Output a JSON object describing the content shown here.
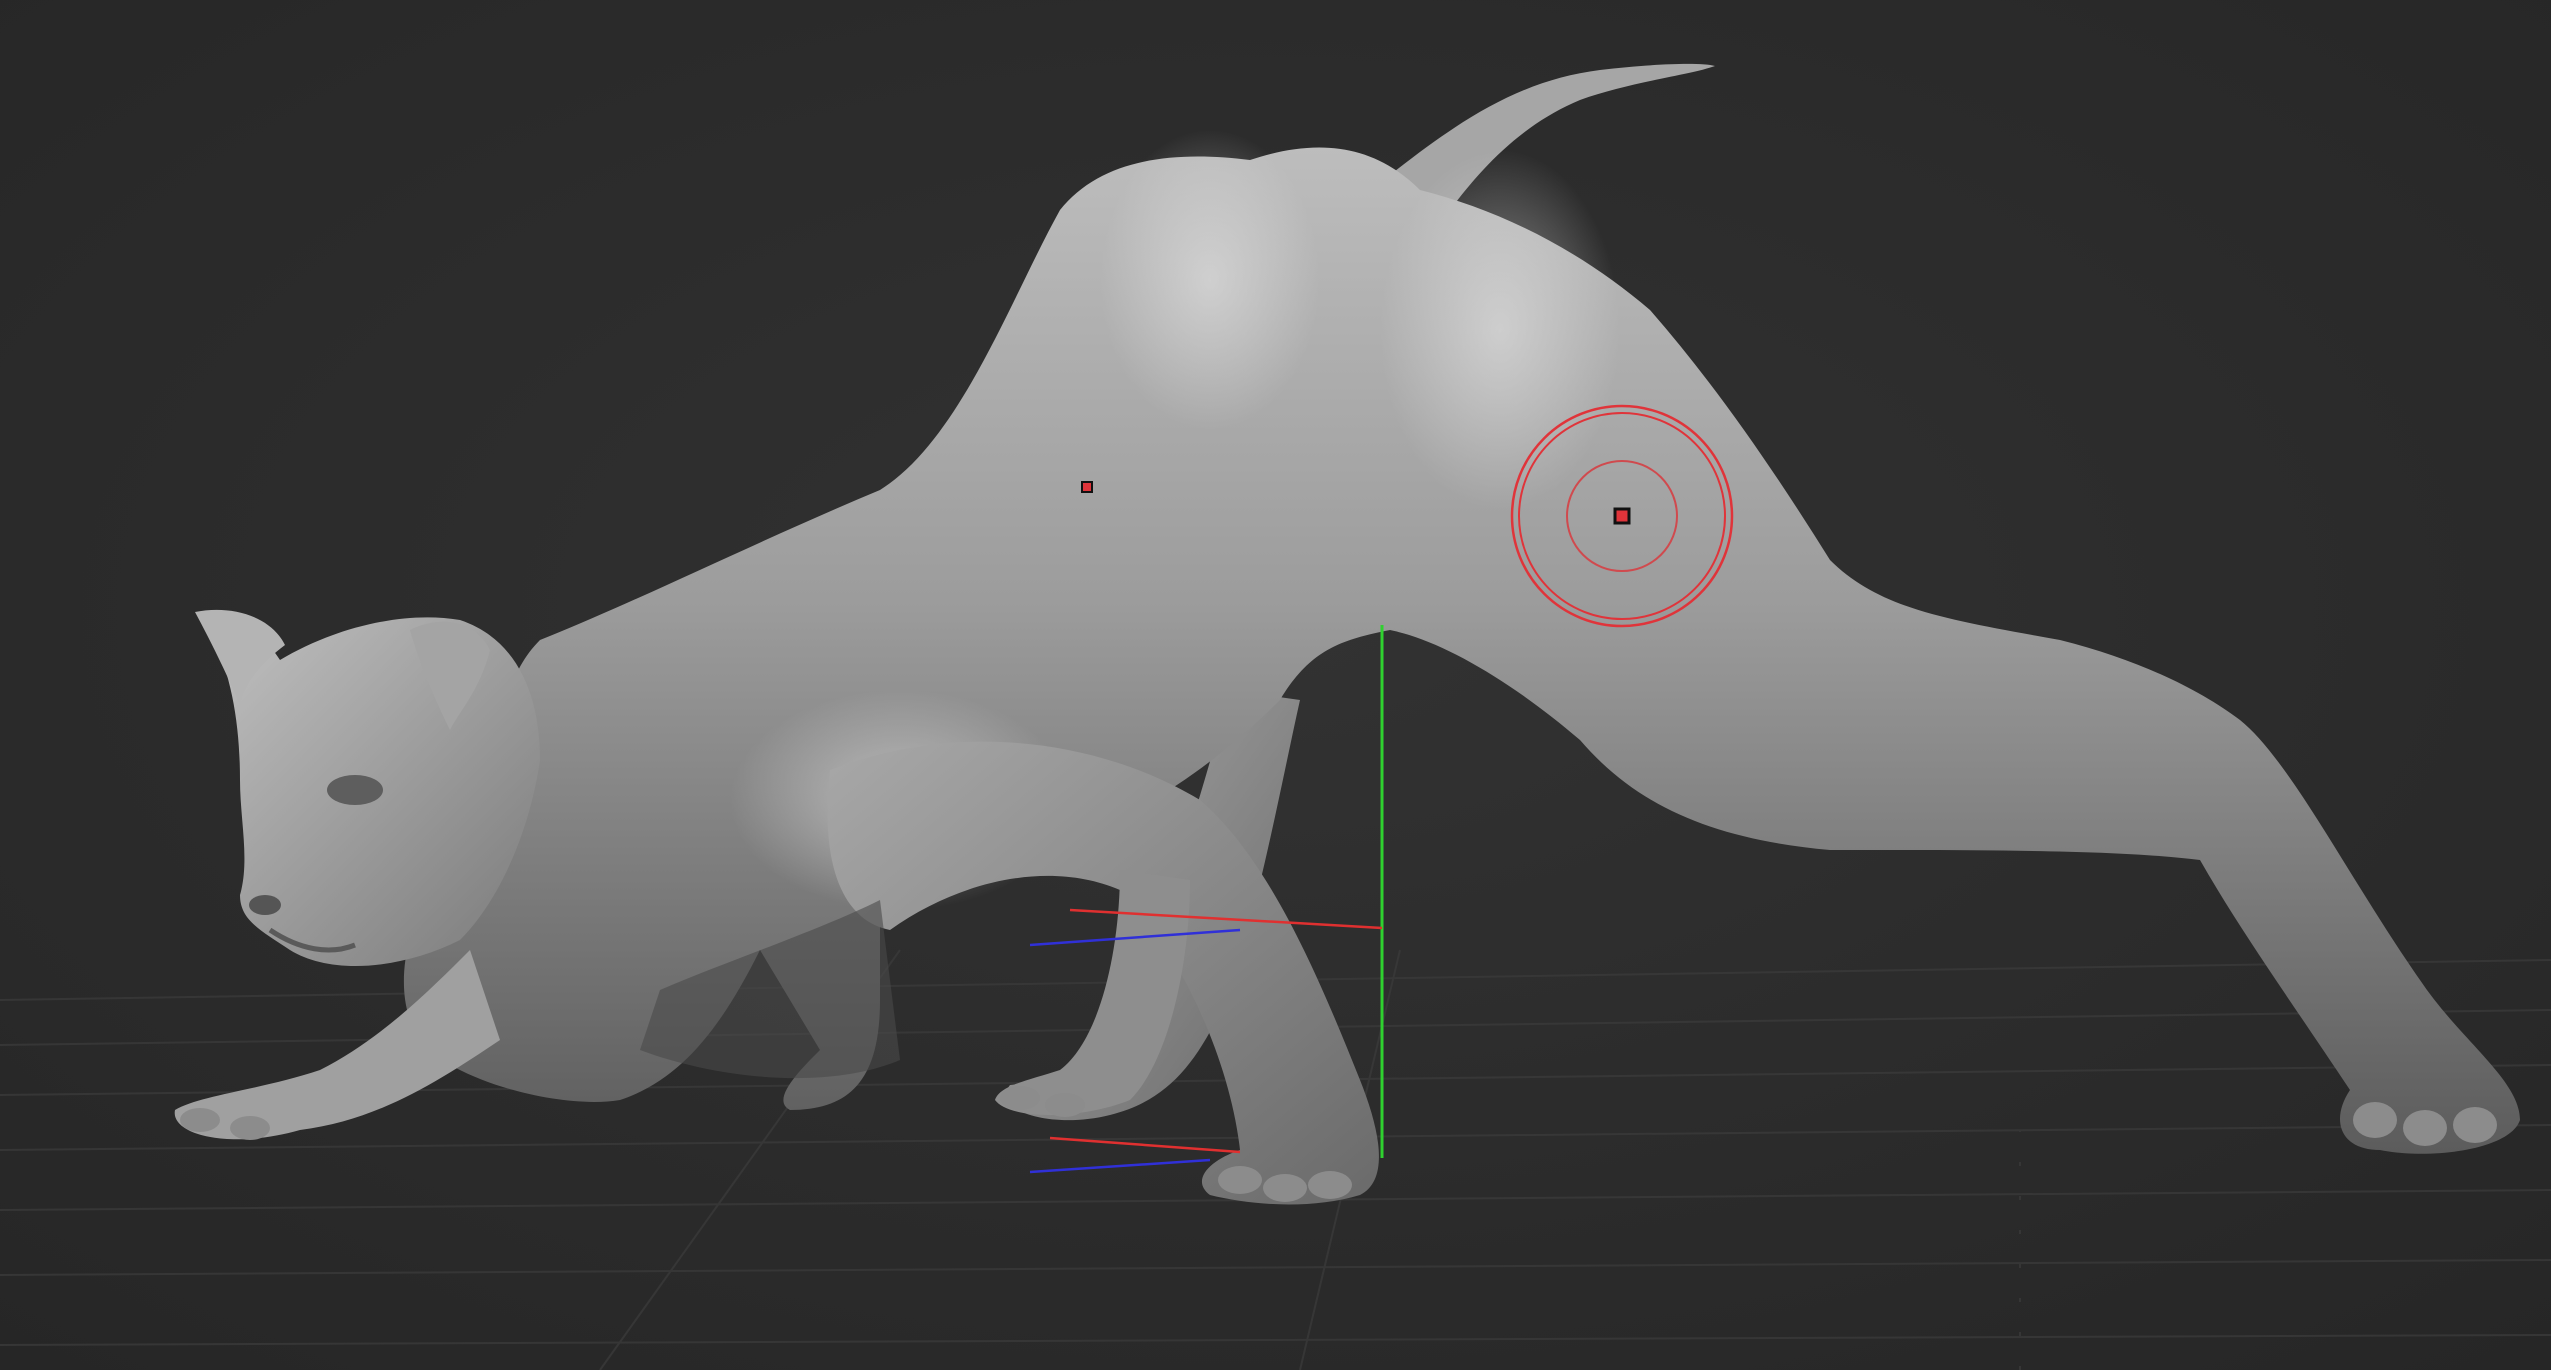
{
  "viewport": {
    "background": "#2b2b2b",
    "floor_grid": "visible",
    "model": "cat sculpt"
  },
  "colors": {
    "background": "#2b2b2b",
    "mesh": "#9a9a9a",
    "brush_cursor": "#e0343a",
    "gizmo_y_axis": "#2fd12f",
    "gizmo_x_axis": "#e03030",
    "gizmo_z_axis": "#3030d8",
    "corner_marker": "#ffffff"
  },
  "icons": {
    "brush_cursor": "brush-cursor-icon",
    "pivot_point": "pivot-point-icon",
    "transpose_gizmo": "transpose-gizmo-icon"
  }
}
